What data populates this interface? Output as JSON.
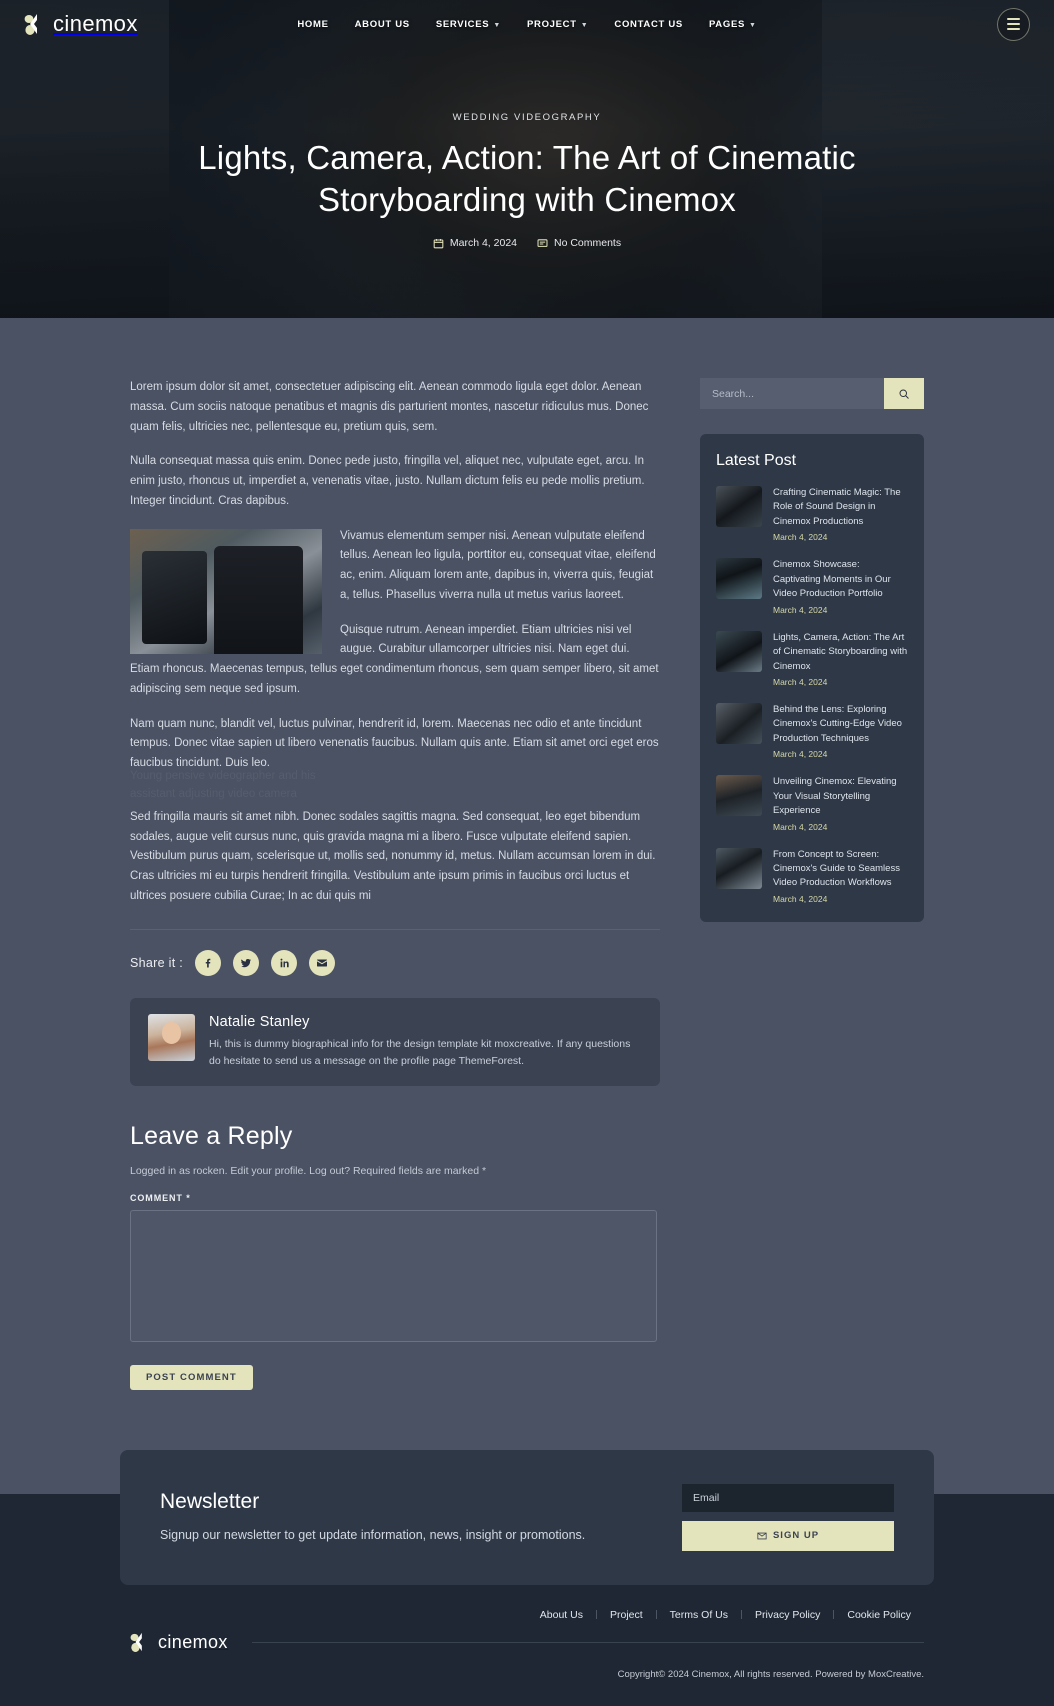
{
  "brand": {
    "name": "cinemox",
    "accent": "#e4e4bc",
    "page_bg": "#4b5263",
    "panel_bg": "#2e3847",
    "footer_bg": "#1e2733"
  },
  "nav": {
    "items": [
      {
        "label": "HOME",
        "has_dropdown": false
      },
      {
        "label": "ABOUT US",
        "has_dropdown": false
      },
      {
        "label": "SERVICES",
        "has_dropdown": true
      },
      {
        "label": "PROJECT",
        "has_dropdown": true
      },
      {
        "label": "CONTACT US",
        "has_dropdown": false
      },
      {
        "label": "PAGES",
        "has_dropdown": true
      }
    ],
    "menu_icon": "hamburger-icon"
  },
  "hero": {
    "eyebrow": "WEDDING VIDEOGRAPHY",
    "title": "Lights, Camera, Action: The Art of Cinematic Storyboarding with Cinemox",
    "date": "March 4, 2024",
    "comments": "No Comments",
    "date_icon": "calendar-icon",
    "comment_icon": "comment-icon"
  },
  "article": {
    "p1": "Lorem ipsum dolor sit amet, consectetuer adipiscing elit. Aenean commodo ligula eget dolor. Aenean massa. Cum sociis natoque penatibus et magnis dis parturient montes, nascetur ridiculus mus. Donec quam felis, ultricies nec, pellentesque eu, pretium quis, sem.",
    "p2": "Nulla consequat massa quis enim. Donec pede justo, fringilla vel, aliquet nec, vulputate eget, arcu. In enim justo, rhoncus ut, imperdiet a, venenatis vitae, justo. Nullam dictum felis eu pede mollis pretium. Integer tincidunt. Cras dapibus.",
    "p3": "Vivamus elementum semper nisi. Aenean vulputate eleifend tellus. Aenean leo ligula, porttitor eu, consequat vitae, eleifend ac, enim. Aliquam lorem ante, dapibus in, viverra quis, feugiat a, tellus. Phasellus viverra nulla ut metus varius laoreet.",
    "p4": "Quisque rutrum. Aenean imperdiet. Etiam ultricies nisi vel augue. Curabitur ullamcorper ultricies nisi. Nam eget dui. Etiam rhoncus. Maecenas tempus, tellus eget condimentum rhoncus, sem quam semper libero, sit amet adipiscing sem neque sed ipsum.",
    "p5": "Nam quam nunc, blandit vel, luctus pulvinar, hendrerit id, lorem. Maecenas nec odio et ante tincidunt tempus. Donec vitae sapien ut libero venenatis faucibus. Nullam quis ante. Etiam sit amet orci eget eros faucibus tincidunt. Duis leo.",
    "p6": "Sed fringilla mauris sit amet nibh. Donec sodales sagittis magna. Sed consequat, leo eget bibendum sodales, augue velit cursus nunc, quis gravida magna mi a libero. Fusce vulputate eleifend sapien. Vestibulum purus quam, scelerisque ut, mollis sed, nonummy id, metus. Nullam accumsan lorem in dui. Cras ultricies mi eu turpis hendrerit fringilla. Vestibulum ante ipsum primis in faucibus orci luctus et ultrices posuere cubilia Curae; In ac dui quis mi",
    "figure_caption": "Young pensive videographer and his assistant adjusting video camera"
  },
  "share": {
    "label": "Share it :",
    "networks": [
      {
        "name": "facebook-icon"
      },
      {
        "name": "twitter-icon"
      },
      {
        "name": "linkedin-icon"
      },
      {
        "name": "email-icon"
      }
    ]
  },
  "author": {
    "name": "Natalie Stanley",
    "bio": "Hi, this is dummy biographical info for the design template kit moxcreative. If any questions do hesitate to send us a message on the profile page ThemeForest."
  },
  "reply": {
    "title": "Leave a Reply",
    "logged_text": "Logged in as rocken. Edit your profile. Log out? Required fields are marked *",
    "comment_label": "COMMENT *",
    "comment_value": "",
    "submit_label": "POST COMMENT"
  },
  "sidebar": {
    "search": {
      "placeholder": "Search...",
      "value": "",
      "icon": "search-icon"
    },
    "latest": {
      "title": "Latest Post",
      "posts": [
        {
          "title": "Crafting Cinematic Magic: The Role of Sound Design in Cinemox Productions",
          "date": "March 4, 2024"
        },
        {
          "title": "Cinemox Showcase: Captivating Moments in Our Video Production Portfolio",
          "date": "March 4, 2024"
        },
        {
          "title": "Lights, Camera, Action: The Art of Cinematic Storyboarding with Cinemox",
          "date": "March 4, 2024"
        },
        {
          "title": "Behind the Lens: Exploring Cinemox's Cutting-Edge Video Production Techniques",
          "date": "March 4, 2024"
        },
        {
          "title": "Unveiling Cinemox: Elevating Your Visual Storytelling Experience",
          "date": "March 4, 2024"
        },
        {
          "title": "From Concept to Screen: Cinemox's Guide to Seamless Video Production Workflows",
          "date": "March 4, 2024"
        }
      ]
    }
  },
  "newsletter": {
    "title": "Newsletter",
    "description": "Signup our newsletter to get update information, news, insight or promotions.",
    "email_placeholder": "Email",
    "email_value": "",
    "button_label": "SIGN UP",
    "button_icon": "envelope-icon"
  },
  "footer": {
    "links": [
      "About Us",
      "Project",
      "Terms Of Us",
      "Privacy Policy",
      "Cookie Policy"
    ],
    "copyright": "Copyright© 2024 Cinemox, All rights reserved. Powered by MoxCreative."
  }
}
